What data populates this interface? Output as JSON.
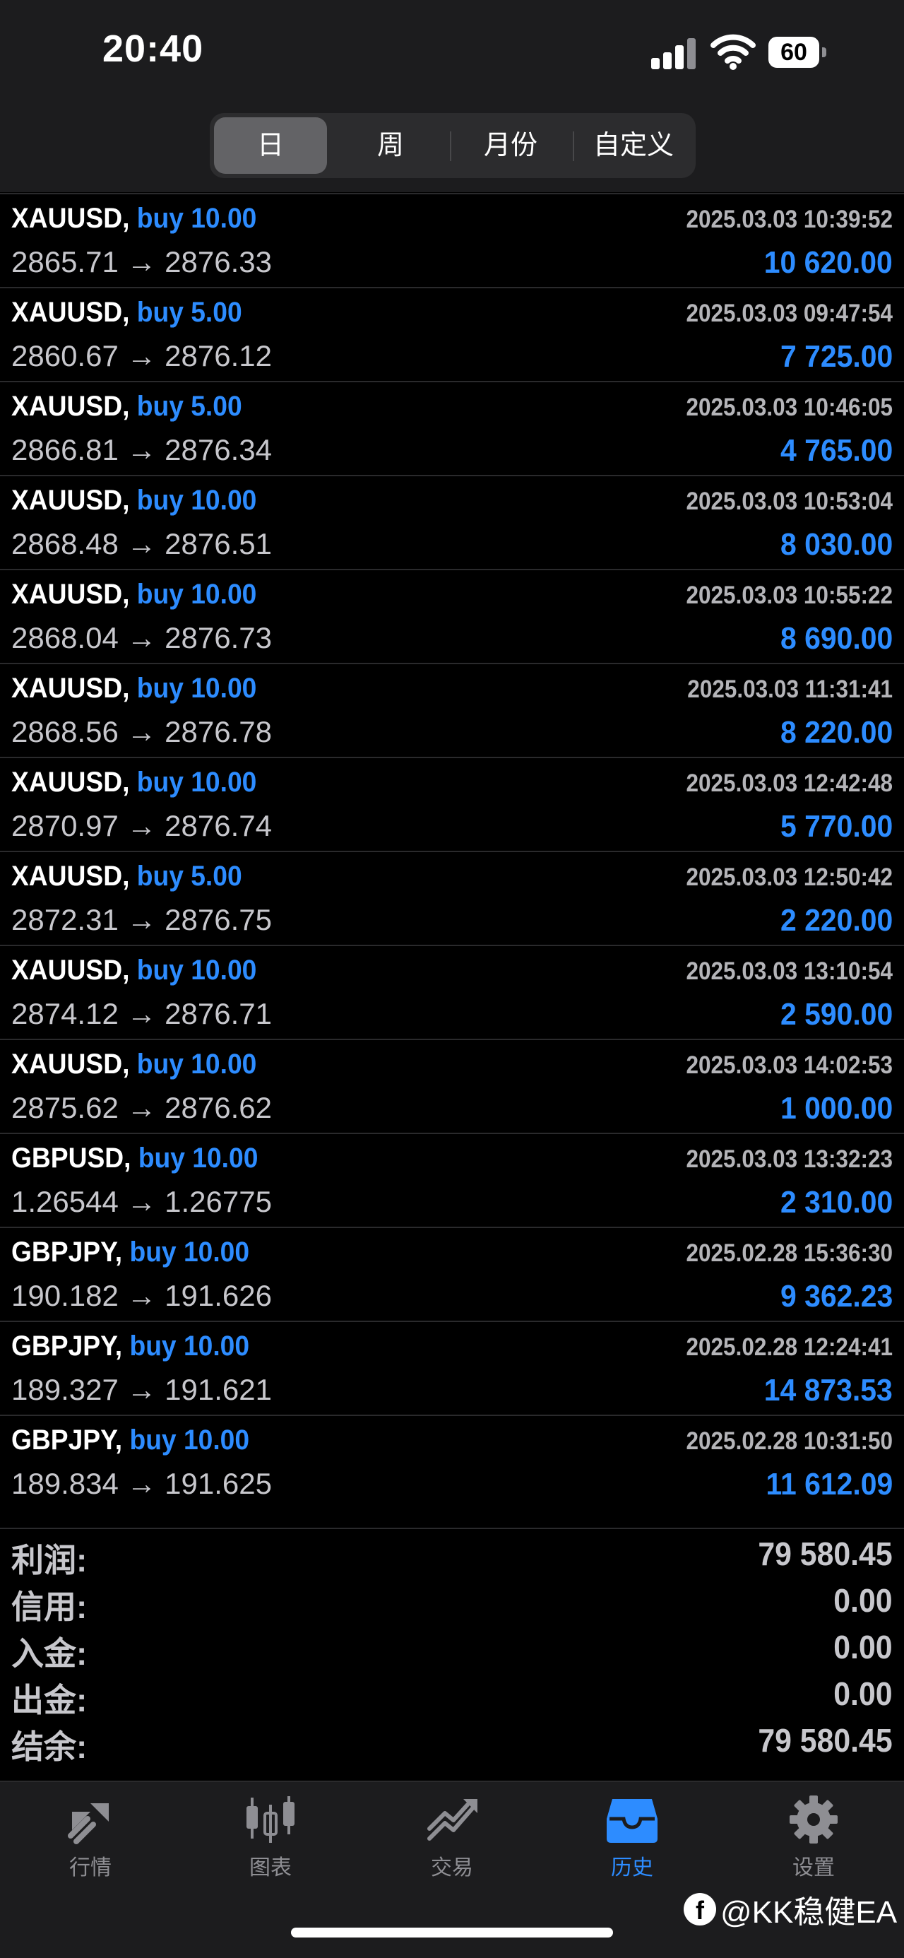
{
  "status_bar": {
    "time": "20:40",
    "battery": "60"
  },
  "segments": [
    "日",
    "周",
    "月份",
    "自定义"
  ],
  "deals": [
    {
      "symbol": "XAUUSD,",
      "trade": "buy 10.00",
      "time": "2025.03.03 10:39:52",
      "prices": "2865.71 → 2876.33",
      "profit": "10 620.00"
    },
    {
      "symbol": "XAUUSD,",
      "trade": "buy 5.00",
      "time": "2025.03.03 09:47:54",
      "prices": "2860.67 → 2876.12",
      "profit": "7 725.00"
    },
    {
      "symbol": "XAUUSD,",
      "trade": "buy 5.00",
      "time": "2025.03.03 10:46:05",
      "prices": "2866.81 → 2876.34",
      "profit": "4 765.00"
    },
    {
      "symbol": "XAUUSD,",
      "trade": "buy 10.00",
      "time": "2025.03.03 10:53:04",
      "prices": "2868.48 → 2876.51",
      "profit": "8 030.00"
    },
    {
      "symbol": "XAUUSD,",
      "trade": "buy 10.00",
      "time": "2025.03.03 10:55:22",
      "prices": "2868.04 → 2876.73",
      "profit": "8 690.00"
    },
    {
      "symbol": "XAUUSD,",
      "trade": "buy 10.00",
      "time": "2025.03.03 11:31:41",
      "prices": "2868.56 → 2876.78",
      "profit": "8 220.00"
    },
    {
      "symbol": "XAUUSD,",
      "trade": "buy 10.00",
      "time": "2025.03.03 12:42:48",
      "prices": "2870.97 → 2876.74",
      "profit": "5 770.00"
    },
    {
      "symbol": "XAUUSD,",
      "trade": "buy 5.00",
      "time": "2025.03.03 12:50:42",
      "prices": "2872.31 → 2876.75",
      "profit": "2 220.00"
    },
    {
      "symbol": "XAUUSD,",
      "trade": "buy 10.00",
      "time": "2025.03.03 13:10:54",
      "prices": "2874.12 → 2876.71",
      "profit": "2 590.00"
    },
    {
      "symbol": "XAUUSD,",
      "trade": "buy 10.00",
      "time": "2025.03.03 14:02:53",
      "prices": "2875.62 → 2876.62",
      "profit": "1 000.00"
    },
    {
      "symbol": "GBPUSD,",
      "trade": "buy 10.00",
      "time": "2025.03.03 13:32:23",
      "prices": "1.26544 → 1.26775",
      "profit": "2 310.00"
    },
    {
      "symbol": "GBPJPY,",
      "trade": "buy 10.00",
      "time": "2025.02.28 15:36:30",
      "prices": "190.182 → 191.626",
      "profit": "9 362.23"
    },
    {
      "symbol": "GBPJPY,",
      "trade": "buy 10.00",
      "time": "2025.02.28 12:24:41",
      "prices": "189.327 → 191.621",
      "profit": "14 873.53"
    },
    {
      "symbol": "GBPJPY,",
      "trade": "buy 10.00",
      "time": "2025.02.28 10:31:50",
      "prices": "189.834 → 191.625",
      "profit": "11 612.09"
    }
  ],
  "summary": [
    {
      "label": "利润:",
      "value": "79 580.45"
    },
    {
      "label": "信用:",
      "value": "0.00"
    },
    {
      "label": "入金:",
      "value": "0.00"
    },
    {
      "label": "出金:",
      "value": "0.00"
    },
    {
      "label": "结余:",
      "value": "79 580.45"
    }
  ],
  "tabs": [
    {
      "label": "行情",
      "icon": "quotes-icon"
    },
    {
      "label": "图表",
      "icon": "chart-icon"
    },
    {
      "label": "交易",
      "icon": "trade-icon"
    },
    {
      "label": "历史",
      "icon": "history-icon"
    },
    {
      "label": "设置",
      "icon": "settings-icon"
    }
  ],
  "watermark": "@KK稳健EA",
  "colors": {
    "accent": "#2d8cff",
    "background": "#000000",
    "panel": "#1c1c1e"
  }
}
